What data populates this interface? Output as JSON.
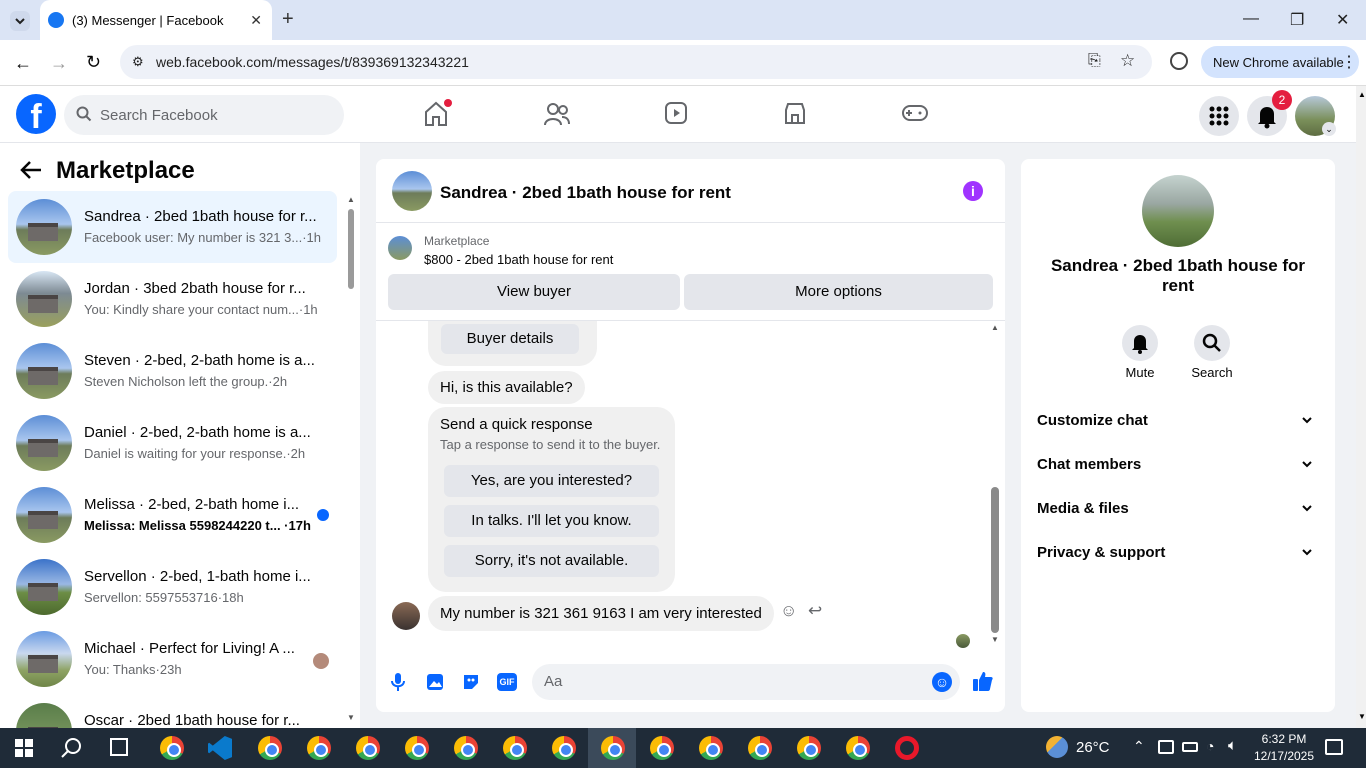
{
  "browser": {
    "tab_title": "(3) Messenger | Facebook",
    "url": "web.facebook.com/messages/t/839369132343221",
    "new_chrome_label": "New Chrome available"
  },
  "fb_header": {
    "search_placeholder": "Search Facebook",
    "notification_count": "2"
  },
  "sidebar": {
    "title": "Marketplace",
    "conversations": [
      {
        "title": "Sandrea · 2bed 1bath house for r...",
        "subtitle": "Facebook user: My number is 321 3...·1h",
        "active": true
      },
      {
        "title": "Jordan · 3bed 2bath house for r...",
        "subtitle": "You: Kindly share your contact num...·1h"
      },
      {
        "title": "Steven · 2-bed, 2-bath home is a...",
        "subtitle": "Steven Nicholson left the group.·2h"
      },
      {
        "title": "Daniel · 2-bed, 2-bath home is a...",
        "subtitle": "Daniel is waiting for your response.·2h"
      },
      {
        "title": "Melissa · 2-bed, 2-bath home i...",
        "subtitle": "Melissa: Melissa 5598244220 t... ·17h",
        "unread": true
      },
      {
        "title": "Servellon · 2-bed, 1-bath home i...",
        "subtitle": "Servellon: 5597553716·18h"
      },
      {
        "title": "Michael · Perfect for Living! A ...",
        "subtitle": "You: Thanks·23h"
      },
      {
        "title": "Oscar · 2bed 1bath house for r...",
        "subtitle": ""
      }
    ]
  },
  "chat": {
    "header_title": "Sandrea · 2bed 1bath house for rent",
    "marketplace_label": "Marketplace",
    "listing": "$800 - 2bed 1bath house for rent",
    "view_buyer": "View buyer",
    "more_options": "More options",
    "buyer_details": "Buyer details",
    "msg_available": "Hi, is this available?",
    "quick_title": "Send a quick response",
    "quick_sub": "Tap a response to send it to the buyer.",
    "quick_options": [
      "Yes, are you interested?",
      "In talks. I'll let you know.",
      "Sorry, it's not available."
    ],
    "msg_number": "My number is 321 361 9163 I am very interested",
    "composer_placeholder": "Aa"
  },
  "info_panel": {
    "title": "Sandrea · 2bed 1bath house for rent",
    "mute": "Mute",
    "search": "Search",
    "sections": [
      "Customize chat",
      "Chat members",
      "Media & files",
      "Privacy & support"
    ]
  },
  "taskbar": {
    "weather": "26°C",
    "time": "6:32 PM",
    "date": "12/17/2025"
  },
  "colors": {
    "facebook_blue": "#0866ff",
    "info_purple": "#a033ff"
  }
}
